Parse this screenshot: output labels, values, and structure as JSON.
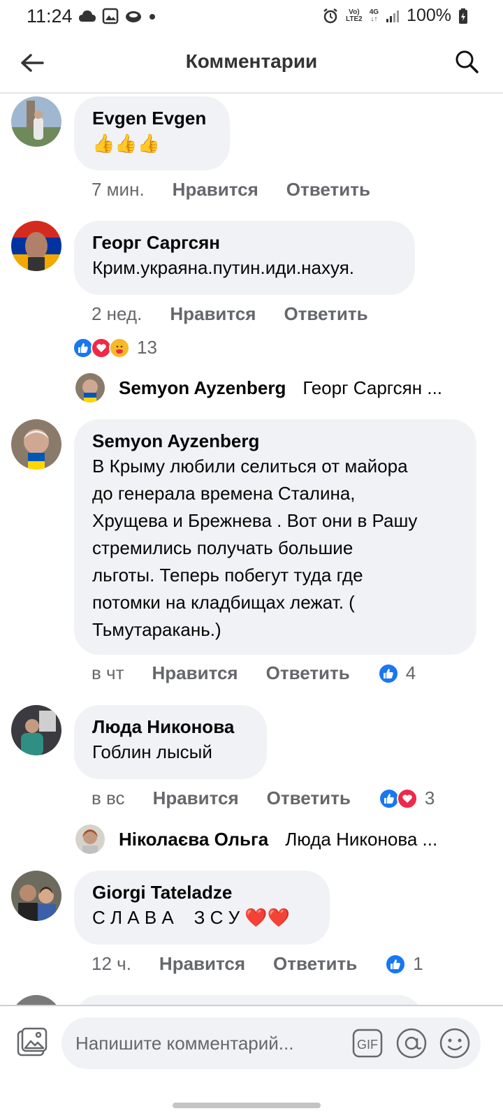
{
  "status_bar": {
    "time": "11:24",
    "volte": "Vo)",
    "lte": "LTE2",
    "network": "4G",
    "battery": "100%"
  },
  "header": {
    "title": "Комментарии"
  },
  "comments": [
    {
      "author": "Evgen Evgen",
      "text": "👍👍👍",
      "time": "7 мин.",
      "like_label": "Нравится",
      "reply_label": "Ответить"
    },
    {
      "author": "Георг Саргсян",
      "text": "Крим.украяна.путин.иди.нахуя.",
      "time": "2 нед.",
      "like_label": "Нравится",
      "reply_label": "Ответить",
      "reaction_count": "13",
      "reply_preview": {
        "author": "Semyon Ayzenberg",
        "text": "Георг Саргсян ..."
      }
    },
    {
      "author": "Semyon Ayzenberg",
      "text_lines": [
        "В Крыму любили селиться от майора",
        "до генерала времена Сталина,",
        "Хрущева и Брежнева . Вот они в Рашу",
        "стремились получать большие",
        "льготы. Теперь побегут туда где",
        "потомки на кладбищах лежат. (",
        "Тьмутаракань.)"
      ],
      "time": "в чт",
      "like_label": "Нравится",
      "reply_label": "Ответить",
      "reaction_count": "4"
    },
    {
      "author": "Люда Никонова",
      "text": "Гоблин лысый",
      "time": "в вс",
      "like_label": "Нравится",
      "reply_label": "Ответить",
      "reaction_count": "3",
      "reply_preview": {
        "author": "Ніколаєва Ольга",
        "text": "Люда Никонова ..."
      }
    },
    {
      "author": "Giorgi Tateladze",
      "text": "С Л А В А    З С У ❤️❤️",
      "time": "12 ч.",
      "like_label": "Нравится",
      "reply_label": "Ответить",
      "reaction_count": "1"
    }
  ],
  "composer": {
    "placeholder": "Напишите комментарий...",
    "gif_label": "GIF"
  },
  "colors": {
    "like_blue": "#1877f2",
    "love_red": "#f02849",
    "bubble_gray": "#f0f2f5",
    "meta_gray": "#65676b"
  }
}
